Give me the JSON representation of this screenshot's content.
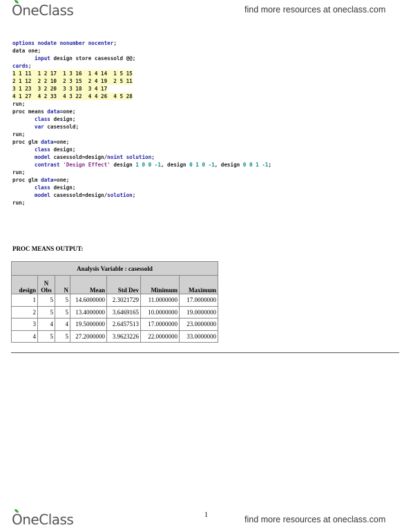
{
  "header": {
    "logo": "OneClass",
    "tagline": "find more resources at oneclass.com"
  },
  "code": [
    [
      [
        "kw",
        "options nodate nonumber nocenter"
      ],
      [
        "",
        "; "
      ]
    ],
    [
      [
        "",
        "data one;"
      ]
    ],
    [
      [
        "",
        "       "
      ],
      [
        "kw",
        "input"
      ],
      [
        "",
        " design store casessold @@;"
      ]
    ],
    [
      [
        "kw",
        "cards"
      ],
      [
        "",
        ";"
      ]
    ],
    [
      [
        "hl",
        "1 1 11  1 2 17  1 3 16  1 4 14  1 5 15"
      ]
    ],
    [
      [
        "hl",
        "2 1 12  2 2 10  2 3 15  2 4 19  2 5 11"
      ]
    ],
    [
      [
        "hl",
        "3 1 23  3 2 20  3 3 18  3 4 17"
      ]
    ],
    [
      [
        "hl",
        "4 1 27  4 2 33  4 3 22  4 4 26  4 5 28"
      ]
    ],
    [
      [
        "",
        "run;"
      ]
    ],
    [
      [
        "",
        "proc means "
      ],
      [
        "kw",
        "data"
      ],
      [
        "",
        "=one;"
      ]
    ],
    [
      [
        "",
        "       "
      ],
      [
        "kw",
        "class"
      ],
      [
        "",
        " design;"
      ]
    ],
    [
      [
        "",
        "       "
      ],
      [
        "kw",
        "var"
      ],
      [
        "",
        " casessold;"
      ]
    ],
    [
      [
        "",
        "run;"
      ]
    ],
    [
      [
        "",
        "proc glm "
      ],
      [
        "kw",
        "data"
      ],
      [
        "",
        "=one;"
      ]
    ],
    [
      [
        "",
        "       "
      ],
      [
        "kw",
        "class"
      ],
      [
        "",
        " design;"
      ]
    ],
    [
      [
        "",
        "       "
      ],
      [
        "kw",
        "model"
      ],
      [
        "",
        " casessold=design/"
      ],
      [
        "kw",
        "noint solution"
      ],
      [
        "",
        ";"
      ]
    ],
    [
      [
        "",
        "       "
      ],
      [
        "kw",
        "contrast"
      ],
      [
        "",
        " "
      ],
      [
        "str",
        "'Design Effect'"
      ],
      [
        "",
        " design "
      ],
      [
        "num",
        "1 0 0 -1"
      ],
      [
        "",
        ", design "
      ],
      [
        "num",
        "0 1 0 -1"
      ],
      [
        "",
        ", design "
      ],
      [
        "num",
        "0 0 1 -1"
      ],
      [
        "",
        ";"
      ]
    ],
    [
      [
        "",
        "run;"
      ]
    ],
    [
      [
        "",
        "proc glm "
      ],
      [
        "kw",
        "data"
      ],
      [
        "",
        "=one;"
      ]
    ],
    [
      [
        "",
        "       "
      ],
      [
        "kw",
        "class"
      ],
      [
        "",
        " design;"
      ]
    ],
    [
      [
        "",
        "       "
      ],
      [
        "kw",
        "model"
      ],
      [
        "",
        " casessold=design/"
      ],
      [
        "kw",
        "solution"
      ],
      [
        "",
        ";"
      ]
    ],
    [
      [
        "",
        "run;"
      ]
    ]
  ],
  "section_heading": "PROC MEANS OUTPUT:",
  "table": {
    "title": "Analysis Variable : casessold",
    "columns": [
      "design",
      "N Obs",
      "N",
      "Mean",
      "Std Dev",
      "Minimum",
      "Maximum"
    ],
    "rows": [
      [
        "1",
        "5",
        "5",
        "14.6000000",
        "2.3021729",
        "11.0000000",
        "17.0000000"
      ],
      [
        "2",
        "5",
        "5",
        "13.4000000",
        "3.6469165",
        "10.0000000",
        "19.0000000"
      ],
      [
        "3",
        "4",
        "4",
        "19.5000000",
        "2.6457513",
        "17.0000000",
        "23.0000000"
      ],
      [
        "4",
        "5",
        "5",
        "27.2000000",
        "3.9623226",
        "22.0000000",
        "33.0000000"
      ]
    ]
  },
  "footer": {
    "page_number": "1",
    "logo": "OneClass",
    "tagline": "find more resources at oneclass.com"
  }
}
